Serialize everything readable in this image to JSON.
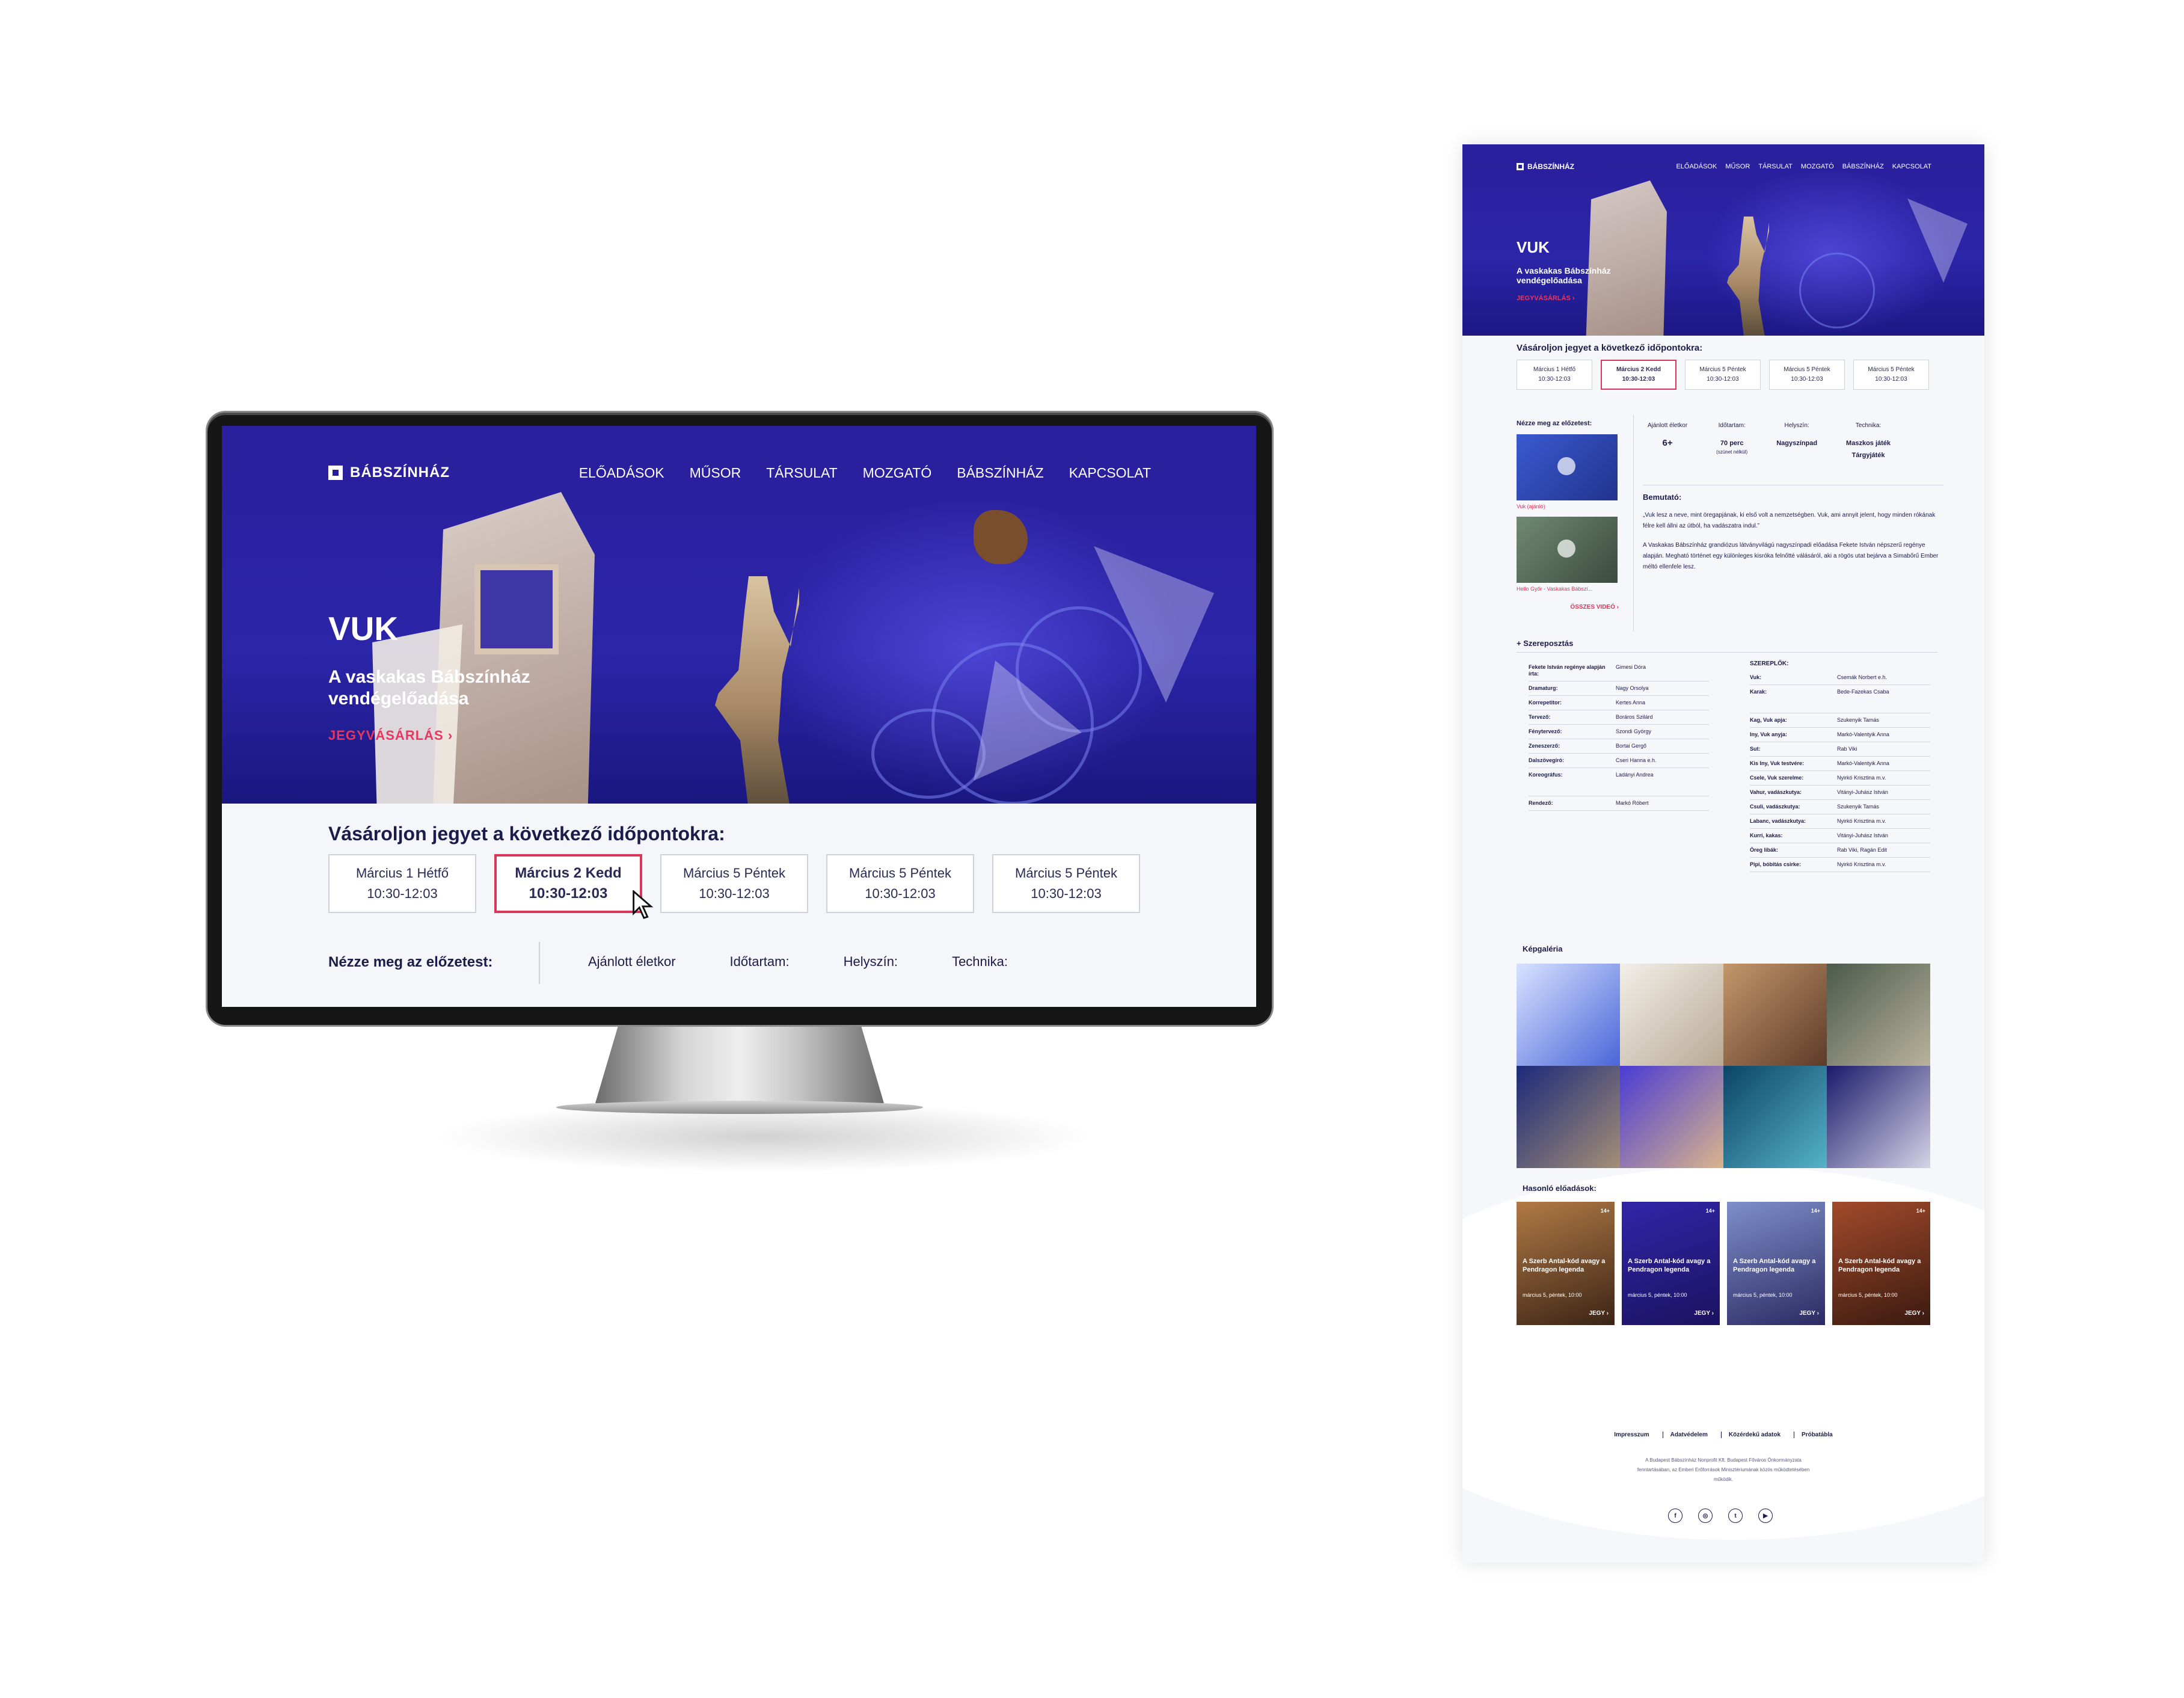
{
  "site": {
    "logo": "BÁBSZÍNHÁZ",
    "nav": [
      "ELŐADÁSOK",
      "MŰSOR",
      "TÁRSULAT",
      "MOZGATÓ",
      "BÁBSZÍNHÁZ",
      "KAPCSOLAT"
    ]
  },
  "hero": {
    "title": "VUK",
    "subtitle": "A vaskakas Bábszínház vendégelőadása",
    "cta": "JEGYVÁSÁRLÁS ›"
  },
  "tickets": {
    "title": "Vásároljon jegyet a következő időpontokra:",
    "dates": [
      {
        "day": "Március 1 Hétfő",
        "time": "10:30-12:03"
      },
      {
        "day": "Március 2 Kedd",
        "time": "10:30-12:03"
      },
      {
        "day": "Március 5 Péntek",
        "time": "10:30-12:03"
      },
      {
        "day": "Március 5 Péntek",
        "time": "10:30-12:03"
      },
      {
        "day": "Március 5 Péntek",
        "time": "10:30-12:03"
      }
    ]
  },
  "preview": {
    "title": "Nézze meg az előzetest:",
    "videos": [
      "Vuk (ajánló)",
      "Hello Győr - Vaskakas Bábszí..."
    ],
    "all": "ÖSSZES VIDEÓ ›"
  },
  "stats": {
    "labels": [
      "Ajánlott életkor",
      "Időtartam:",
      "Helyszín:",
      "Technika:"
    ],
    "age": "6+",
    "duration": "70 perc",
    "duration_note": "(szünet nélkül)",
    "venue": "Nagyszínpad",
    "tech1": "Maszkos játék",
    "tech2": "Tárgyjáték"
  },
  "about": {
    "title": "Bemutató:",
    "p1": "„Vuk lesz a neve, mint öregapjának, ki első volt a nemzetségben. Vuk, ami annyit jelent, hogy minden rókának félre kell állni az útból, ha vadászatra indul.”",
    "p2": "A Vaskakas Bábszínház grandiózus látványvilágú nagyszínpadi előadása Fekete István népszerű regénye alapján. Megható történet egy különleges kisróka felnőtté válásáról, aki a rögös utat bejárva a Simabőrű Ember méltó ellenfele lesz."
  },
  "cast": {
    "title": "Szereposztás",
    "crew": [
      {
        "role": "Fekete István regénye alapján írta:",
        "name": "Gimesi Dóra"
      },
      {
        "role": "Dramaturg:",
        "name": "Nagy Orsolya"
      },
      {
        "role": "Korrepetitor:",
        "name": "Kertes Anna"
      },
      {
        "role": "Tervező:",
        "name": "Boráros Szilárd"
      },
      {
        "role": "Fénytervező:",
        "name": "Szondi György"
      },
      {
        "role": "Zeneszerző:",
        "name": "Bortai Gergő"
      },
      {
        "role": "Dalszövegíró:",
        "name": "Cseri Hanna e.h."
      },
      {
        "role": "Koreográfus:",
        "name": "Ladányi Andrea"
      },
      {
        "role": "Rendező:",
        "name": "Markó Róbert"
      }
    ],
    "players_title": "SZEREPLŐK:",
    "players": [
      {
        "role": "Vuk:",
        "name": "Csemák Norbert e.h."
      },
      {
        "role": "Karak:",
        "name": "Bede-Fazekas Csaba"
      },
      {
        "role": "Kag, Vuk apja:",
        "name": "Szukenyik Tamás"
      },
      {
        "role": "Iny, Vuk anyja:",
        "name": "Markó-Valentyik Anna"
      },
      {
        "role": "Sut:",
        "name": "Rab Viki"
      },
      {
        "role": "Kis Iny, Vuk testvére:",
        "name": "Markó-Valentyik Anna"
      },
      {
        "role": "Csele, Vuk szerelme:",
        "name": "Nyirkó Krisztina m.v."
      },
      {
        "role": "Vahur, vadászkutya:",
        "name": "Vitányi-Juhász István"
      },
      {
        "role": "Csuli, vadászkutya:",
        "name": "Szukenyik Tamás"
      },
      {
        "role": "Labanc, vadászkutya:",
        "name": "Nyirkó Krisztina m.v."
      },
      {
        "role": "Kurri, kakas:",
        "name": "Vitányi-Juhász István"
      },
      {
        "role": "Öreg libák:",
        "name": "Rab Viki, Ragán Edit"
      },
      {
        "role": "Pipi, bóbitás csirke:",
        "name": "Nyirkó Krisztina m.v."
      }
    ]
  },
  "gallery": {
    "title": "Képgaléria"
  },
  "similar": {
    "title": "Hasonló előadások:",
    "items": [
      {
        "age": "14+",
        "title": "A Szerb Antal-kód avagy a Pendragon legenda",
        "date": "március 5, péntek, 10:00",
        "cta": "JEGY ›"
      },
      {
        "age": "14+",
        "title": "A Szerb Antal-kód avagy a Pendragon legenda",
        "date": "március 5, péntek, 10:00",
        "cta": "JEGY ›"
      },
      {
        "age": "14+",
        "title": "A Szerb Antal-kód avagy a Pendragon legenda",
        "date": "március 5, péntek, 10:00",
        "cta": "JEGY ›"
      },
      {
        "age": "14+",
        "title": "A Szerb Antal-kód avagy a Pendragon legenda",
        "date": "március 5, péntek, 10:00",
        "cta": "JEGY ›"
      }
    ]
  },
  "footer": {
    "links": [
      "Impresszum",
      "Adatvédelem",
      "Közérdekű adatok",
      "Próbatábla"
    ],
    "text": "A Budapest Bábszínház Nonprofit Kft. Budapest Főváros Önkormányzata fenntartásában, az Emberi Erőforrások Minisztériumának közös működtetésében működik.",
    "social": [
      "f",
      "◎",
      "t",
      "▶"
    ]
  },
  "colors": {
    "brand": "#2b25a8",
    "accent": "#d9365a",
    "text": "#1b1c4a"
  }
}
